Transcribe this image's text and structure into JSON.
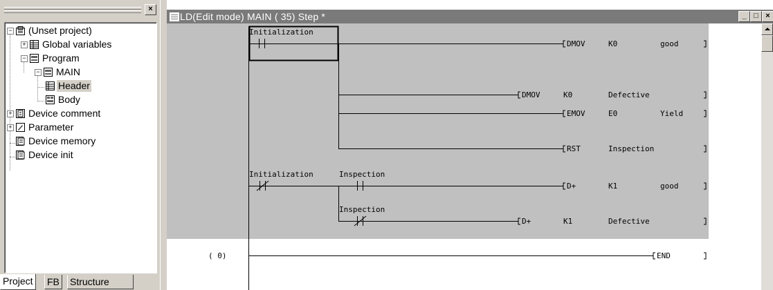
{
  "project_panel": {
    "close_label": "×",
    "tree": [
      {
        "label": "(Unset project)",
        "icon": "project-icon",
        "expander": "−"
      },
      {
        "label": "Global variables",
        "icon": "global-variables-icon",
        "expander": "+"
      },
      {
        "label": "Program",
        "icon": "program-folder-icon",
        "expander": "−"
      },
      {
        "label": "MAIN",
        "icon": "program-icon",
        "expander": "−"
      },
      {
        "label": "Header",
        "icon": "header-icon",
        "selected": true
      },
      {
        "label": "Body",
        "icon": "body-icon"
      },
      {
        "label": "Device comment",
        "icon": "device-comment-icon",
        "expander": "+"
      },
      {
        "label": "Parameter",
        "icon": "parameter-icon",
        "expander": "+"
      },
      {
        "label": "Device memory",
        "icon": "device-memory-icon"
      },
      {
        "label": "Device init",
        "icon": "device-init-icon"
      }
    ],
    "tabs": [
      "Project",
      "FB",
      "Structure"
    ]
  },
  "editor": {
    "title": "LD(Edit mode)   MAIN   (   35) Step *",
    "window_buttons": {
      "minimize": "_",
      "maximize": "□",
      "close": "×"
    },
    "rungs": {
      "contact_initialization": "Initialization",
      "dmov1": {
        "op": "DMOV",
        "src": "K0",
        "dst": "good"
      },
      "dmov2": {
        "op": "DMOV",
        "src": "K0",
        "dst": "Defective"
      },
      "emov": {
        "op": "EMOV",
        "src": "E0",
        "dst": "Yield"
      },
      "rst": {
        "op": "RST",
        "dst": "Inspection"
      },
      "contact_init_nc": "Initialization",
      "contact_inspection_no": "Inspection",
      "dplus1": {
        "op": "D+",
        "src": "K1",
        "dst": "good"
      },
      "contact_inspection_nc": "Inspection",
      "dplus2": {
        "op": "D+",
        "src": "K1",
        "dst": "Defective"
      },
      "end_step": "(      0)",
      "end_label": "END"
    }
  }
}
